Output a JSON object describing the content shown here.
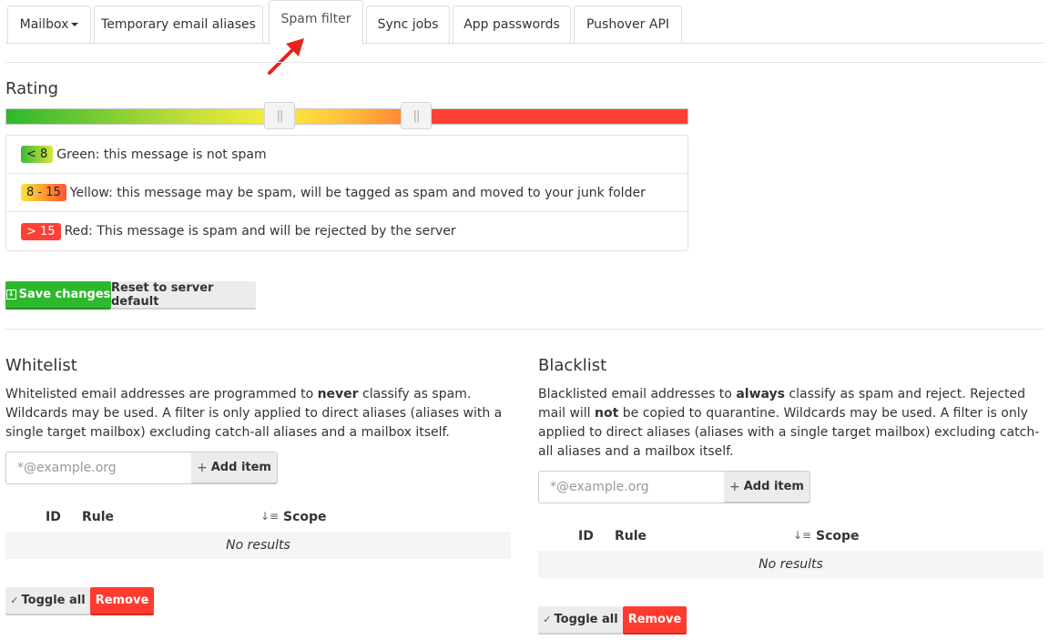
{
  "tabs": [
    {
      "label": "Mailbox",
      "has_caret": true
    },
    {
      "label": "Temporary email aliases"
    },
    {
      "label": "Spam filter",
      "active": true
    },
    {
      "label": "Sync jobs"
    },
    {
      "label": "App passwords"
    },
    {
      "label": "Pushover API"
    }
  ],
  "rating": {
    "title": "Rating",
    "legend": [
      {
        "badge": "< 8",
        "text": "Green: this message is not spam"
      },
      {
        "badge": "8 - 15",
        "text": "Yellow: this message may be spam, will be tagged as spam and moved to your junk folder"
      },
      {
        "badge": "> 15",
        "text": "Red: This message is spam and will be rejected by the server"
      }
    ],
    "save_label": "Save changes",
    "reset_label": "Reset to server default"
  },
  "whitelist": {
    "title": "Whitelist",
    "desc_1": "Whitelisted email addresses are programmed to ",
    "desc_bold": "never",
    "desc_2": " classify as spam. Wildcards may be used. A filter is only applied to direct aliases (aliases with a single target mailbox) excluding catch-all aliases and a mailbox itself.",
    "placeholder": "*@example.org",
    "add_label": "Add item",
    "col_id": "ID",
    "col_rule": "Rule",
    "col_scope": "Scope",
    "empty": "No results",
    "toggle_label": "Toggle all",
    "remove_label": "Remove"
  },
  "blacklist": {
    "title": "Blacklist",
    "desc_1": "Blacklisted email addresses to ",
    "desc_bold": "always",
    "desc_2": " classify as spam and reject. Rejected mail will ",
    "desc_bold2": "not",
    "desc_3": " be copied to quarantine. Wildcards may be used. A filter is only applied to direct aliases (aliases with a single target mailbox) excluding catch-all aliases and a mailbox itself.",
    "placeholder": "*@example.org",
    "add_label": "Add item",
    "col_id": "ID",
    "col_rule": "Rule",
    "col_scope": "Scope",
    "empty": "No results",
    "toggle_label": "Toggle all",
    "remove_label": "Remove"
  },
  "colors": {
    "green": "#2db82d",
    "red": "#ff3b30",
    "annotation_arrow": "#e8231e"
  }
}
